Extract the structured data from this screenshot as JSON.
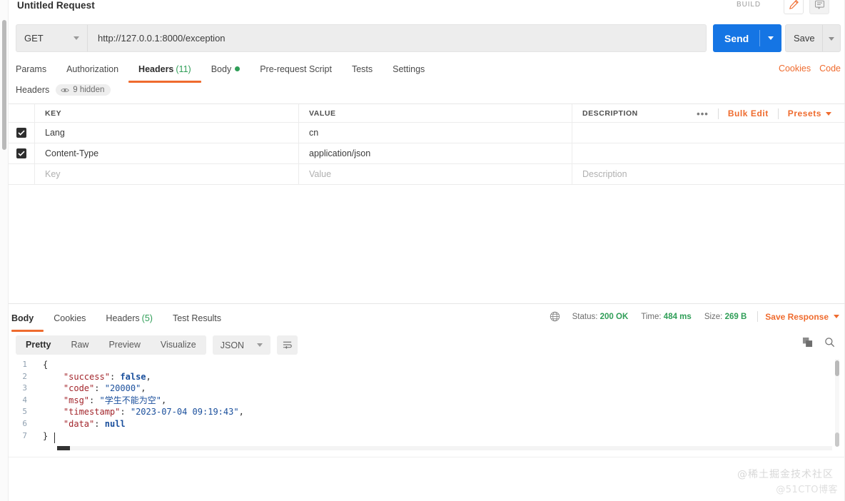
{
  "request": {
    "title": "Untitled Request",
    "build_label": "BUILD",
    "edit_icon": "pencil-icon",
    "comment_icon": "comment-icon",
    "method": "GET",
    "url": "http://127.0.0.1:8000/exception",
    "send_label": "Send",
    "save_label": "Save",
    "tabs": [
      {
        "label": "Params",
        "count": "",
        "active": false,
        "dot": false
      },
      {
        "label": "Authorization",
        "count": "",
        "active": false,
        "dot": false
      },
      {
        "label": "Headers",
        "count": "(11)",
        "active": true,
        "dot": false
      },
      {
        "label": "Body",
        "count": "",
        "active": false,
        "dot": true
      },
      {
        "label": "Pre-request Script",
        "count": "",
        "active": false,
        "dot": false
      },
      {
        "label": "Tests",
        "count": "",
        "active": false,
        "dot": false
      },
      {
        "label": "Settings",
        "count": "",
        "active": false,
        "dot": false
      }
    ],
    "top_links": [
      "Cookies",
      "Code"
    ]
  },
  "headers_panel": {
    "label": "Headers",
    "hidden_badge": "9 hidden",
    "eye_icon": "eye-icon",
    "columns": [
      "KEY",
      "VALUE",
      "DESCRIPTION"
    ],
    "more_icon": "more-dots-icon",
    "bulk_edit_label": "Bulk Edit",
    "presets_label": "Presets",
    "rows": [
      {
        "checked": true,
        "key": "Lang",
        "value": "cn",
        "description": ""
      },
      {
        "checked": true,
        "key": "Content-Type",
        "value": "application/json",
        "description": ""
      }
    ],
    "placeholder_row": {
      "key": "Key",
      "value": "Value",
      "description": "Description"
    }
  },
  "response": {
    "tabs": [
      {
        "label": "Body",
        "count": "",
        "active": true
      },
      {
        "label": "Cookies",
        "count": "",
        "active": false
      },
      {
        "label": "Headers",
        "count": "(5)",
        "active": false
      },
      {
        "label": "Test Results",
        "count": "",
        "active": false
      }
    ],
    "globe_icon": "globe-icon",
    "status_label": "Status:",
    "status_value": "200 OK",
    "time_label": "Time:",
    "time_value": "484 ms",
    "size_label": "Size:",
    "size_value": "269 B",
    "save_response_label": "Save Response",
    "view_modes": [
      {
        "label": "Pretty",
        "active": true
      },
      {
        "label": "Raw",
        "active": false
      },
      {
        "label": "Preview",
        "active": false
      },
      {
        "label": "Visualize",
        "active": false
      }
    ],
    "format": "JSON",
    "wrap_icon": "wrap-lines-icon",
    "copy_icon": "copy-icon",
    "search_icon": "search-icon",
    "line_numbers": [
      "1",
      "2",
      "3",
      "4",
      "5",
      "6",
      "7"
    ],
    "body_lines": [
      {
        "indent": 0,
        "tokens": [
          {
            "t": "pun",
            "v": "{"
          }
        ]
      },
      {
        "indent": 1,
        "tokens": [
          {
            "t": "key",
            "v": "\"success\""
          },
          {
            "t": "pun",
            "v": ": "
          },
          {
            "t": "lit",
            "v": "false"
          },
          {
            "t": "pun",
            "v": ","
          }
        ]
      },
      {
        "indent": 1,
        "tokens": [
          {
            "t": "key",
            "v": "\"code\""
          },
          {
            "t": "pun",
            "v": ": "
          },
          {
            "t": "str",
            "v": "\"20000\""
          },
          {
            "t": "pun",
            "v": ","
          }
        ]
      },
      {
        "indent": 1,
        "tokens": [
          {
            "t": "key",
            "v": "\"msg\""
          },
          {
            "t": "pun",
            "v": ": "
          },
          {
            "t": "str",
            "v": "\"学生不能为空\""
          },
          {
            "t": "pun",
            "v": ","
          }
        ]
      },
      {
        "indent": 1,
        "tokens": [
          {
            "t": "key",
            "v": "\"timestamp\""
          },
          {
            "t": "pun",
            "v": ": "
          },
          {
            "t": "str",
            "v": "\"2023-07-04 09:19:43\""
          },
          {
            "t": "pun",
            "v": ","
          }
        ]
      },
      {
        "indent": 1,
        "tokens": [
          {
            "t": "key",
            "v": "\"data\""
          },
          {
            "t": "pun",
            "v": ": "
          },
          {
            "t": "lit",
            "v": "null"
          }
        ]
      },
      {
        "indent": 0,
        "tokens": [
          {
            "t": "pun",
            "v": "}"
          }
        ]
      }
    ]
  },
  "watermarks": {
    "primary": "@稀土掘金技术社区",
    "secondary": "@51CTO博客"
  },
  "colors": {
    "accent_orange": "#ef6b2e",
    "send_blue": "#1575e4",
    "success_green": "#2f9e57",
    "json_key": "#a3262c",
    "json_value": "#1a4f9c"
  }
}
